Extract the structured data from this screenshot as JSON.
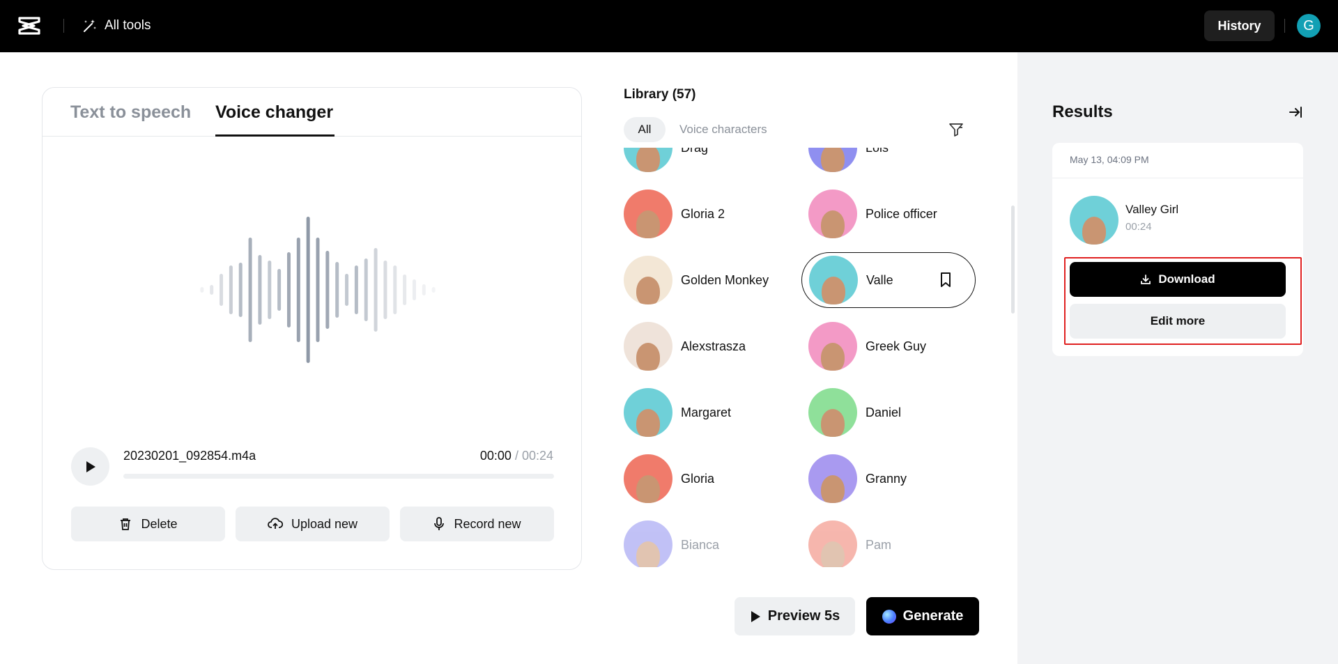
{
  "header": {
    "all_tools_label": "All tools",
    "history_label": "History",
    "user_initial": "G"
  },
  "editor": {
    "tabs": [
      {
        "label": "Text to speech",
        "active": false
      },
      {
        "label": "Voice changer",
        "active": true
      }
    ],
    "file": {
      "name": "20230201_092854.m4a",
      "current_time": "00:00",
      "separator": " / ",
      "total_time": "00:24",
      "progress": 0
    },
    "buttons": {
      "delete": "Delete",
      "upload": "Upload new",
      "record": "Record new"
    }
  },
  "library": {
    "title": "Library (57)",
    "filters": {
      "all": "All",
      "voice_characters": "Voice characters"
    },
    "voices": [
      {
        "name": "Drag",
        "color": "#6fd0d8"
      },
      {
        "name": "Lois",
        "color": "#8f8ff0"
      },
      {
        "name": "Gloria 2",
        "color": "#f07b6b"
      },
      {
        "name": "Police officer",
        "color": "#f39ac6"
      },
      {
        "name": "Golden Monkey",
        "color": "#f3e7d6"
      },
      {
        "name": "Valle",
        "color": "#6fd0d8",
        "selected": true
      },
      {
        "name": "Alexstrasza",
        "color": "#efe3da"
      },
      {
        "name": "Greek Guy",
        "color": "#f39ac6"
      },
      {
        "name": "Margaret",
        "color": "#6fd0d8"
      },
      {
        "name": "Daniel",
        "color": "#8fe09a"
      },
      {
        "name": "Gloria",
        "color": "#f07b6b"
      },
      {
        "name": "Granny",
        "color": "#a99af0"
      },
      {
        "name": "Bianca",
        "color": "#8f8ff0"
      },
      {
        "name": "Pam",
        "color": "#f07b6b"
      }
    ]
  },
  "actions": {
    "preview": "Preview 5s",
    "generate": "Generate"
  },
  "results": {
    "title": "Results",
    "item": {
      "date": "May 13, 04:09 PM",
      "name": "Valley Girl",
      "duration": "00:24",
      "download": "Download",
      "edit_more": "Edit more"
    }
  },
  "colors": {
    "accent": "#000000",
    "highlight": "#e02020",
    "panel_bg": "#f2f3f5"
  }
}
